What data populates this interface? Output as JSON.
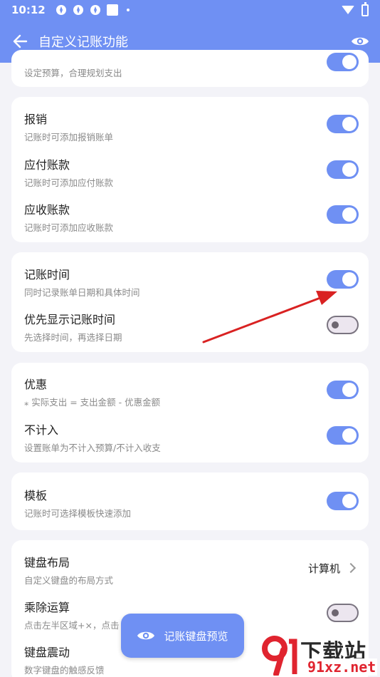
{
  "status_bar": {
    "time": "10:12"
  },
  "app_bar": {
    "title": "自定义记账功能"
  },
  "sections": {
    "budget": {
      "sub": "设定预算，合理规划支出"
    },
    "reimburse": {
      "label": "报销",
      "sub": "记账时可添加报销账单",
      "on": true
    },
    "payable": {
      "label": "应付账款",
      "sub": "记账时可添加应付账款",
      "on": true
    },
    "receivable": {
      "label": "应收账款",
      "sub": "记账时可添加应收账款",
      "on": true
    },
    "record_time": {
      "label": "记账时间",
      "sub": "同时记录账单日期和具体时间",
      "on": true
    },
    "show_time_first": {
      "label": "优先显示记账时间",
      "sub": "先选择时间，再选择日期",
      "on": false
    },
    "discount": {
      "label": "优惠",
      "sub": "⁎ 实际支出 = 支出金额 - 优惠金额",
      "on": true
    },
    "exclude": {
      "label": "不计入",
      "sub": "设置账单为不计入预算/不计入收支",
      "on": true
    },
    "template": {
      "label": "模板",
      "sub": "记账时可选择模板快速添加",
      "on": true
    },
    "keyboard_layout": {
      "label": "键盘布局",
      "sub": "自定义键盘的布局方式",
      "value": "计算机"
    },
    "mult_div": {
      "label": "乘除运算",
      "sub": "点击左半区域+×，点击",
      "on": false
    },
    "keyboard_vibrate": {
      "label": "键盘震动",
      "sub": "数字键盘的触感反馈"
    }
  },
  "fab": {
    "label": "记账键盘预览"
  },
  "watermark": {
    "brand": "下载站",
    "url": "91xz.net"
  },
  "colors": {
    "accent": "#6f90f3",
    "arrow": "#d92222"
  }
}
